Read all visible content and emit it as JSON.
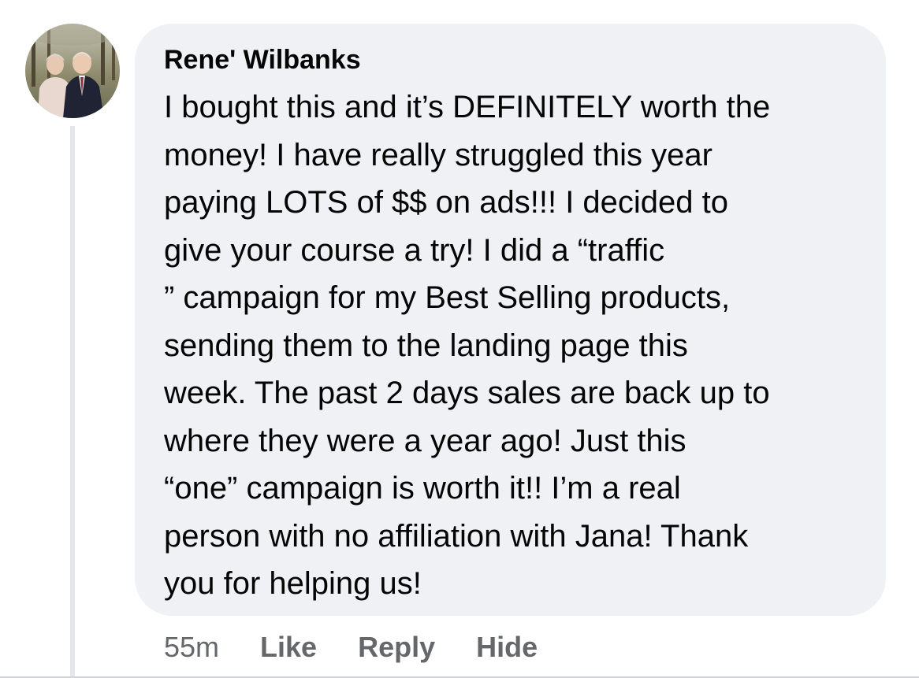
{
  "comment": {
    "author": "Rene' Wilbanks",
    "text_lines": [
      "I bought this and it’s DEFINITELY worth the",
      "money!  I have really struggled this year",
      "paying LOTS of $$  on ads!!!  I decided to",
      "give your course a try!  I did a “traffic",
      "” campaign for my Best Selling products,",
      "sending them to the landing page this",
      "week. The past 2 days sales are back up to",
      "where they were a year ago!  Just this",
      "“one” campaign is worth it!!  I’m a real",
      "person with no affiliation with Jana!  Thank",
      "you for helping us!"
    ],
    "timestamp": "55m",
    "actions": {
      "like": "Like",
      "reply": "Reply",
      "hide": "Hide"
    }
  },
  "colors": {
    "bubble": "#f0f1f5",
    "text": "#050505",
    "secondary_text": "#65676b",
    "thread_line": "#e4e6ea"
  }
}
